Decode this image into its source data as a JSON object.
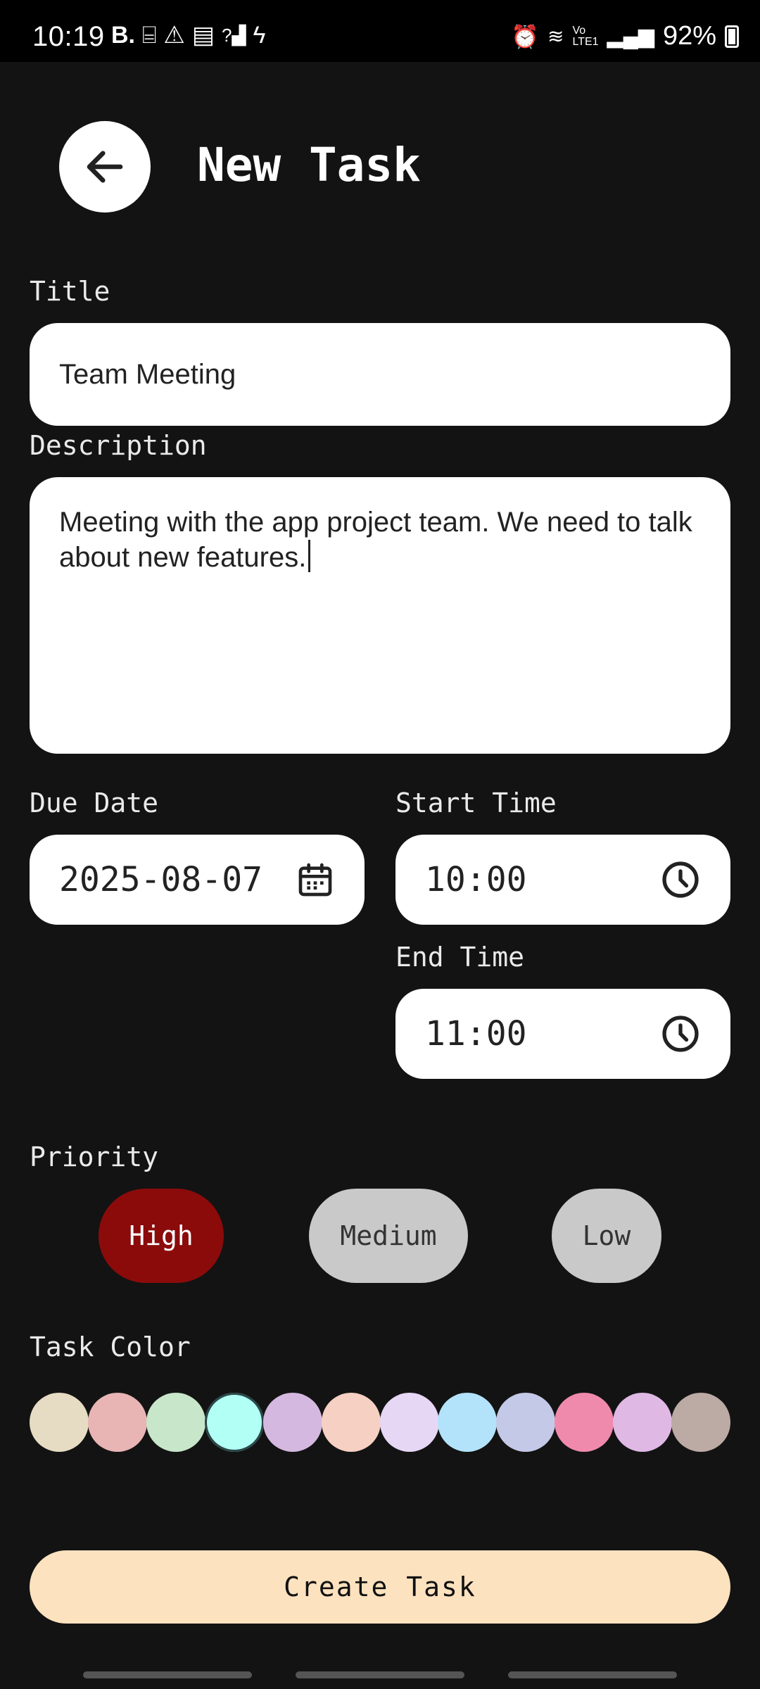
{
  "status_bar": {
    "time": "10:19",
    "left_icons": [
      "B.",
      "voicemail-icon",
      "warning-icon",
      "twitch-icon",
      "signal-unknown-icon",
      "bolt-icon"
    ],
    "battery_percent": "92%"
  },
  "header": {
    "title": "New Task"
  },
  "form": {
    "title_label": "Title",
    "title_value": "Team Meeting",
    "description_label": "Description",
    "description_value": "Meeting with the app project team. We need to talk about new features.",
    "due_date_label": "Due Date",
    "due_date_value": "2025-08-07",
    "start_time_label": "Start Time",
    "start_time_value": "10:00",
    "end_time_label": "End Time",
    "end_time_value": "11:00",
    "priority_label": "Priority",
    "priority_options": [
      "High",
      "Medium",
      "Low"
    ],
    "priority_selected": "High",
    "color_label": "Task Color",
    "colors": [
      "#e6dcc3",
      "#e8b4b4",
      "#c8e6c9",
      "#b2fff6",
      "#d5b8e0",
      "#f6d0c2",
      "#e6d7f5",
      "#b3e3fb",
      "#c5c9e8",
      "#f08aac",
      "#dfb8e4",
      "#bcaaa4"
    ],
    "selected_color_index": 3
  },
  "actions": {
    "create_label": "Create Task"
  },
  "theme": {
    "accent_high": "#8b0b0b",
    "create_button_bg": "#fde2bf",
    "background": "#131313"
  }
}
